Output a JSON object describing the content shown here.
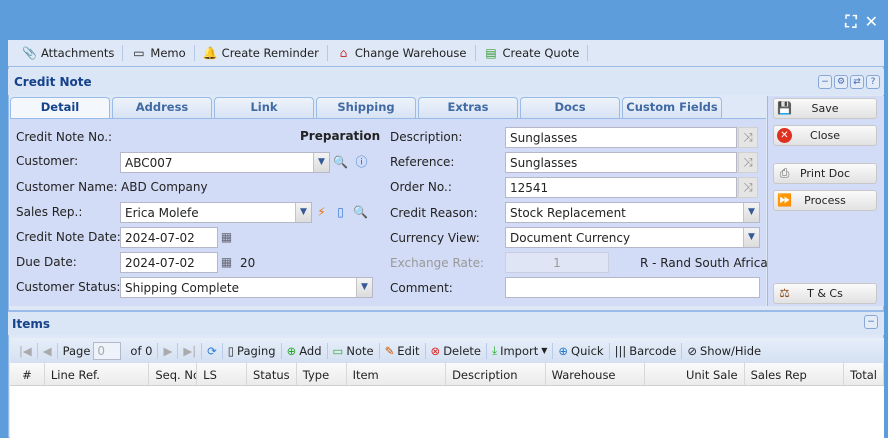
{
  "window": {
    "icons": [
      "maximize-icon",
      "close-icon"
    ]
  },
  "toolbar": {
    "items": [
      {
        "label": "Attachments",
        "icon": "paperclip-icon"
      },
      {
        "label": "Memo",
        "icon": "calendar-icon"
      },
      {
        "label": "Create Reminder",
        "icon": "bell-icon"
      },
      {
        "label": "Change Warehouse",
        "icon": "warehouse-icon"
      },
      {
        "label": "Create Quote",
        "icon": "quote-icon"
      }
    ]
  },
  "header": {
    "title": "Credit Note"
  },
  "tabs": [
    "Detail",
    "Address",
    "Link",
    "Shipping",
    "Extras",
    "Docs",
    "Custom Fields"
  ],
  "form": {
    "credit_note_no_label": "Credit Note No.:",
    "status": "Preparation",
    "customer_label": "Customer:",
    "customer": "ABC007",
    "customer_name_label": "Customer Name:",
    "customer_name": "ABD Company",
    "sales_rep_label": "Sales Rep.:",
    "sales_rep": "Erica Molefe",
    "credit_note_date_label": "Credit Note Date:",
    "credit_note_date": "2024-07-02",
    "due_date_label": "Due Date:",
    "due_date": "2024-07-02",
    "due_days": "20",
    "customer_status_label": "Customer Status:",
    "customer_status": "Shipping Complete",
    "description_label": "Description:",
    "description": "Sunglasses",
    "reference_label": "Reference:",
    "reference": "Sunglasses",
    "order_no_label": "Order No.:",
    "order_no": "12541",
    "credit_reason_label": "Credit Reason:",
    "credit_reason": "Stock Replacement",
    "currency_view_label": "Currency View:",
    "currency_view": "Document Currency",
    "exchange_rate_label": "Exchange Rate:",
    "exchange_rate": "1",
    "currency": "R - Rand South Africa",
    "comment_label": "Comment:",
    "comment": ""
  },
  "actions": {
    "save": "Save",
    "close": "Close",
    "print": "Print Doc",
    "process": "Process",
    "tcs": "T & Cs"
  },
  "items": {
    "title": "Items",
    "paging": {
      "page_label": "Page",
      "page": "0",
      "of": "of 0"
    },
    "toolbar": [
      "Paging",
      "Add",
      "Note",
      "Edit",
      "Delete",
      "Import",
      "Quick",
      "Barcode",
      "Show/Hide"
    ],
    "columns": [
      "#",
      "Line Ref.",
      "Seq. No.",
      "LS",
      "Status",
      "Type",
      "Item",
      "Description",
      "Warehouse",
      "Unit Sale",
      "Sales Rep",
      "Total"
    ]
  }
}
